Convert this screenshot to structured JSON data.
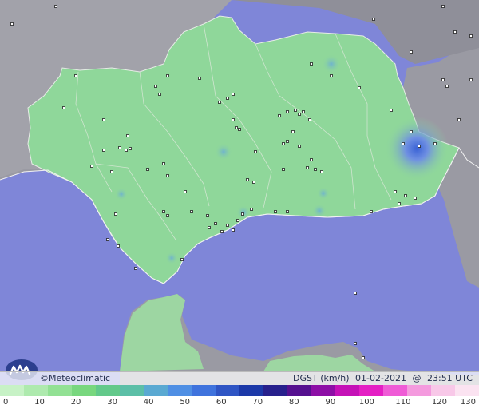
{
  "copyright": "©Meteoclimatic",
  "variable": "DGST (km/h)",
  "date": "01-02-2021",
  "time_separator": "@",
  "time": "23:51 UTC",
  "legend": {
    "ticks": [
      "0",
      "10",
      "20",
      "30",
      "40",
      "50",
      "60",
      "70",
      "80",
      "90",
      "100",
      "110",
      "120",
      "130"
    ],
    "colors": [
      "#c7f2c6",
      "#aeeaae",
      "#92e194",
      "#78d77e",
      "#63c98a",
      "#5cbfa7",
      "#5aa9d2",
      "#4f8fe4",
      "#3f73dd",
      "#2f55c4",
      "#1c39a8",
      "#27208c",
      "#55108f",
      "#8d0fa6",
      "#c512b7",
      "#e41fc4",
      "#ef5bd6",
      "#f49ade",
      "#f8c8e8",
      "#fbe3f1"
    ]
  },
  "colors": {
    "sea": "#7f86d8",
    "land_outside": "#9a9aa3",
    "region": "#8fd79a",
    "gust_spot": "#7e9fe0"
  }
}
